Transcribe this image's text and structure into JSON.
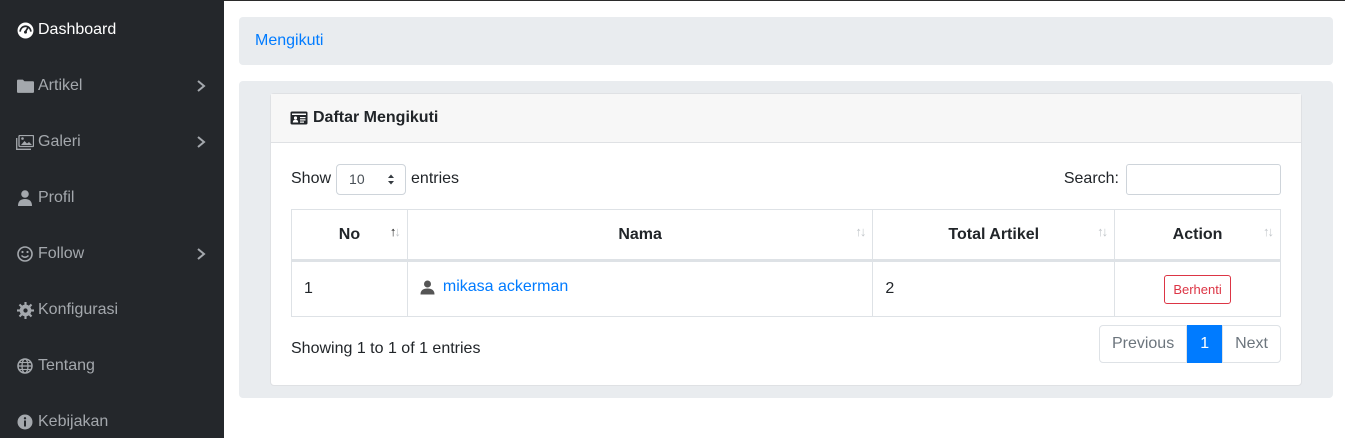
{
  "sidebar": {
    "items": [
      {
        "label": "Dashboard",
        "icon": "dashboard-icon",
        "active": true
      },
      {
        "label": "Artikel",
        "icon": "folder-icon",
        "has_submenu": true
      },
      {
        "label": "Galeri",
        "icon": "images-icon",
        "has_submenu": true
      },
      {
        "label": "Profil",
        "icon": "user-icon"
      },
      {
        "label": "Follow",
        "icon": "smile-icon",
        "has_submenu": true
      },
      {
        "label": "Konfigurasi",
        "icon": "gear-icon"
      },
      {
        "label": "Tentang",
        "icon": "globe-icon"
      },
      {
        "label": "Kebijakan",
        "icon": "info-icon"
      }
    ]
  },
  "breadcrumb": {
    "label": "Mengikuti"
  },
  "card": {
    "title": "Daftar Mengikuti",
    "icon": "id-card-icon"
  },
  "length": {
    "show_label": "Show",
    "value": "10",
    "entries_label": "entries"
  },
  "search": {
    "label": "Search:",
    "value": ""
  },
  "table": {
    "columns": [
      "No",
      "Nama",
      "Total Artikel",
      "Action"
    ],
    "sorted_column": "No",
    "rows": [
      {
        "no": "1",
        "nama": "mikasa ackerman",
        "total_artikel": "2",
        "action": "Berhenti"
      }
    ]
  },
  "info": "Showing 1 to 1 of 1 entries",
  "pagination": {
    "previous": "Previous",
    "current": "1",
    "next": "Next"
  },
  "colors": {
    "sidebar_bg": "#24272b",
    "primary": "#007bff",
    "danger": "#dc3545"
  }
}
